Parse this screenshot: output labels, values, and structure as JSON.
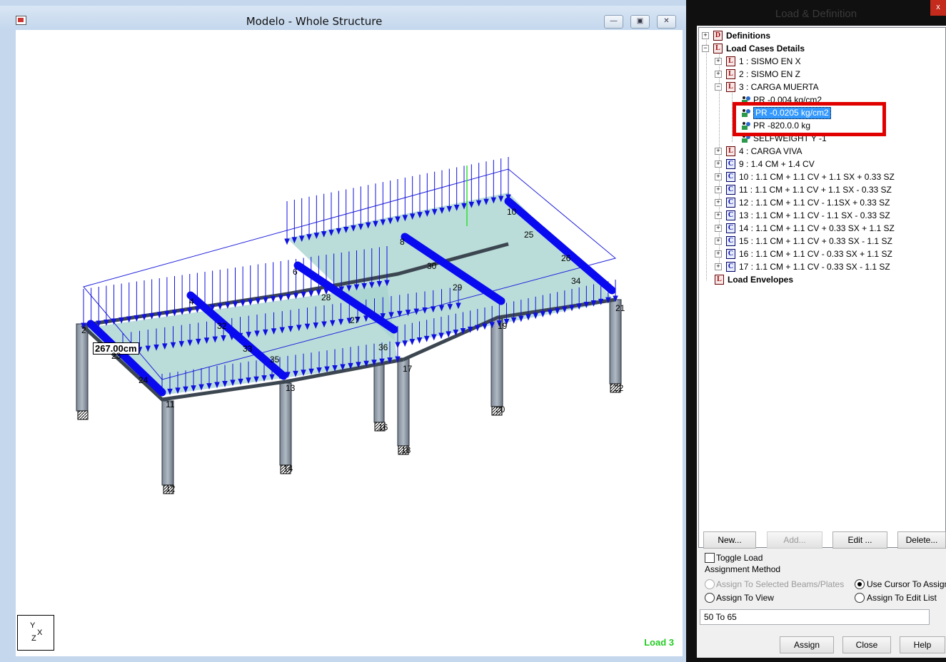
{
  "model_window": {
    "title": "Modelo - Whole Structure",
    "load_indicator": "Load 3",
    "dimension_label": "267.00cm",
    "axis": {
      "y": "Y",
      "x": "X",
      "z": "Z"
    },
    "node_labels": [
      "2",
      "4",
      "6",
      "8",
      "10",
      "11",
      "13",
      "17",
      "19",
      "21",
      "23",
      "24",
      "25",
      "26",
      "27",
      "28",
      "29",
      "30",
      "32",
      "33",
      "34",
      "35",
      "36",
      "12",
      "14",
      "16",
      "18",
      "20",
      "22"
    ]
  },
  "panel": {
    "title": "Load & Definition",
    "close_glyph": "x",
    "tree": {
      "definitions": "Definitions",
      "load_cases_details": "Load Cases Details",
      "cases": [
        {
          "label": "1 : SISMO EN X",
          "icon": "L"
        },
        {
          "label": "2 : SISMO EN Z",
          "icon": "L"
        },
        {
          "label": "3 : CARGA MUERTA",
          "icon": "L"
        }
      ],
      "loads": [
        "PR -0.004  kg/cm2",
        "PR -0.0205  kg/cm2",
        "PR -820.0.0    kg",
        "SELFWEIGHT Y -1"
      ],
      "more_cases": [
        {
          "label": "4 : CARGA VIVA",
          "icon": "L"
        },
        {
          "label": "9 : 1.4 CM + 1.4 CV",
          "icon": "C"
        },
        {
          "label": "10 : 1.1 CM + 1.1 CV + 1.1 SX + 0.33 SZ",
          "icon": "C"
        },
        {
          "label": "11 : 1.1 CM + 1.1 CV + 1.1 SX - 0.33 SZ",
          "icon": "C"
        },
        {
          "label": "12 : 1.1 CM + 1.1 CV - 1.1SX + 0.33 SZ",
          "icon": "C"
        },
        {
          "label": "13 : 1.1 CM + 1.1 CV - 1.1 SX - 0.33 SZ",
          "icon": "C"
        },
        {
          "label": "14 : 1.1 CM + 1.1 CV + 0.33 SX + 1.1 SZ",
          "icon": "C"
        },
        {
          "label": "15 : 1.1 CM + 1.1 CV + 0.33 SX - 1.1 SZ",
          "icon": "C"
        },
        {
          "label": "16 : 1.1 CM + 1.1 CV - 0.33 SX + 1.1 SZ",
          "icon": "C"
        },
        {
          "label": "17 : 1.1 CM + 1.1 CV - 0.33 SX - 1.1 SZ",
          "icon": "C"
        }
      ],
      "load_envelopes": "Load Envelopes"
    },
    "buttons": {
      "new": "New...",
      "add": "Add...",
      "edit": "Edit ...",
      "delete": "Delete..."
    },
    "toggle_load": "Toggle Load",
    "assignment_method": "Assignment Method",
    "radio": {
      "selected_beams": "Assign To Selected Beams/Plates",
      "use_cursor": "Use Cursor To Assign",
      "assign_view": "Assign To View",
      "assign_edit_list": "Assign To Edit List"
    },
    "edit_list_value": "50 To 65",
    "footer": {
      "assign": "Assign",
      "close": "Close",
      "help": "Help"
    }
  }
}
